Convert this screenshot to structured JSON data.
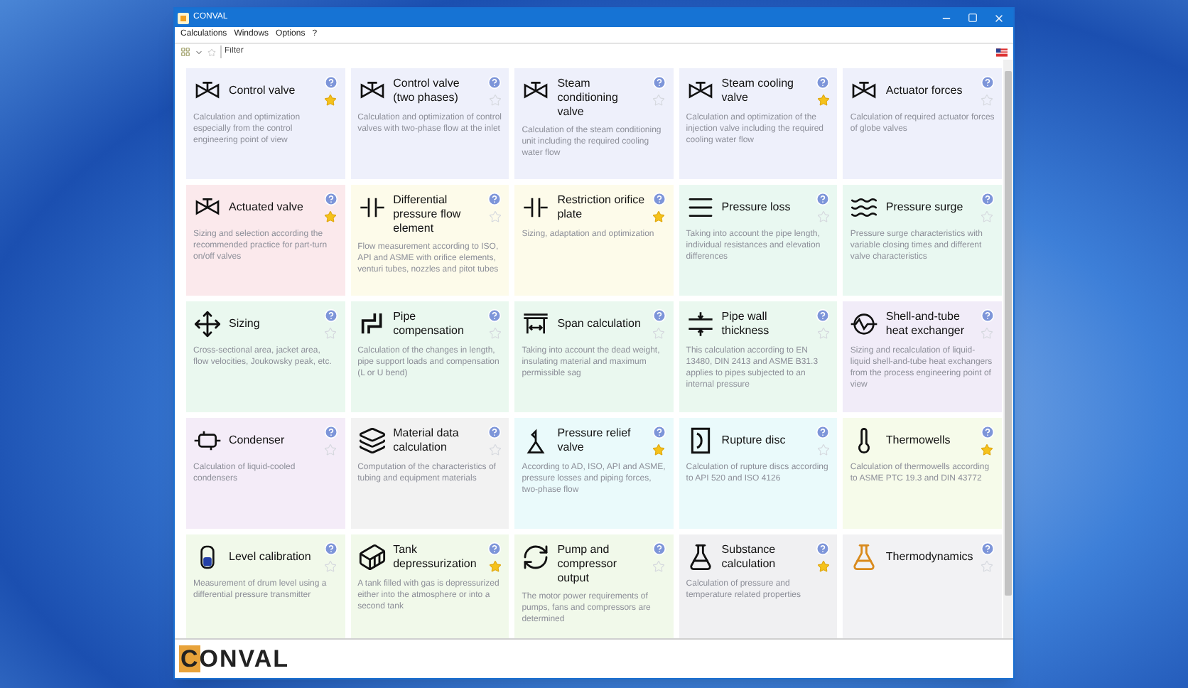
{
  "window": {
    "title": "CONVAL"
  },
  "menu": [
    {
      "label": "Calculations"
    },
    {
      "label": "Windows"
    },
    {
      "label": "Options"
    },
    {
      "label": "?"
    }
  ],
  "toolbar": {
    "filter": {
      "placeholder": "Filter"
    }
  },
  "cards": [
    {
      "title": "Control valve",
      "description": "Calculation and optimization especially from the control engineering point of view",
      "favorite": true,
      "color": "#eef0fb"
    },
    {
      "title": "Control valve (two phases)",
      "description": "Calculation and optimization of control valves with two-phase flow at the inlet",
      "favorite": false,
      "color": "#eef0fb"
    },
    {
      "title": "Steam conditioning valve",
      "description": "Calculation of the steam conditioning unit including the required cooling water flow",
      "favorite": false,
      "color": "#eef0fb"
    },
    {
      "title": "Steam cooling valve",
      "description": "Calculation and optimization of the injection valve including the required cooling water flow",
      "favorite": true,
      "color": "#eef0fb"
    },
    {
      "title": "Actuator forces",
      "description": "Calculation of required actuator forces of globe valves",
      "favorite": false,
      "color": "#eef0fb"
    },
    {
      "title": "Actuated valve",
      "description": "Sizing and selection according the recommended practice for part-turn on/off valves",
      "favorite": true,
      "color": "#fbe9ec"
    },
    {
      "title": "Differential pressure flow element",
      "description": "Flow measurement according to ISO, API and ASME with orifice elements, venturi tubes, nozzles and pitot tubes",
      "favorite": false,
      "color": "#fdfbea"
    },
    {
      "title": "Restriction orifice plate",
      "description": "Sizing, adaptation and optimization",
      "favorite": true,
      "color": "#fdfbea"
    },
    {
      "title": "Pressure loss",
      "description": "Taking into account the pipe length, individual resistances and elevation differences",
      "favorite": false,
      "color": "#e9f8f1"
    },
    {
      "title": "Pressure surge",
      "description": "Pressure surge characteristics with variable closing times and different valve characteristics",
      "favorite": false,
      "color": "#e9f8f1"
    },
    {
      "title": "Sizing",
      "description": "Cross-sectional area, jacket area, flow velocities, Joukowsky peak, etc.",
      "favorite": false,
      "color": "#eaf8ef"
    },
    {
      "title": "Pipe compensation",
      "description": "Calculation of the changes in length, pipe support loads and compensation (L or U bend)",
      "favorite": false,
      "color": "#eaf8ef"
    },
    {
      "title": "Span calculation",
      "description": "Taking into account the dead weight, insulating material and maximum permissible sag",
      "favorite": false,
      "color": "#eaf8ef"
    },
    {
      "title": "Pipe wall thickness",
      "description": "This calculation according to EN 13480, DIN 2413 and ASME B31.3 applies to pipes subjected to an internal pressure",
      "favorite": false,
      "color": "#eaf8ef"
    },
    {
      "title": "Shell-and-tube heat exchanger",
      "description": "Sizing and recalculation of liquid-liquid shell-and-tube heat exchangers from the process engineering point of view",
      "favorite": false,
      "color": "#f1ecf8"
    },
    {
      "title": "Condenser",
      "description": "Calculation of liquid-cooled condensers",
      "favorite": false,
      "color": "#f4ecf8"
    },
    {
      "title": "Material data calculation",
      "description": "Computation of the characteristics of tubing and equipment materials",
      "favorite": false,
      "color": "#f2f2f2"
    },
    {
      "title": "Pressure relief valve",
      "description": "According to AD, ISO, API and ASME, pressure losses and piping forces, two-phase flow",
      "favorite": true,
      "color": "#eafafb"
    },
    {
      "title": "Rupture disc",
      "description": "Calculation of rupture discs according to API 520 and ISO 4126",
      "favorite": false,
      "color": "#eafafb"
    },
    {
      "title": "Thermowells",
      "description": "Calculation of thermowells according to ASME PTC 19.3 and DIN 43772",
      "favorite": true,
      "color": "#f6fbea"
    },
    {
      "title": "Level calibration",
      "description": "Measurement of drum level using a differential pressure transmitter",
      "favorite": false,
      "color": "#f1f9ea"
    },
    {
      "title": "Tank depressurization",
      "description": "A tank filled with gas is depressurized either into the atmosphere or into a second tank",
      "favorite": true,
      "color": "#f1f9ea"
    },
    {
      "title": "Pump and compressor output",
      "description": "The motor power requirements of pumps, fans and compressors are determined",
      "favorite": false,
      "color": "#f1f9ea"
    },
    {
      "title": "Substance calculation",
      "description": "Calculation of pressure and temperature related properties",
      "favorite": true,
      "color": "#f0f0f2"
    },
    {
      "title": "Thermodynamics",
      "favorite": false,
      "color": "#f2f2f4"
    }
  ],
  "logo": {
    "text": "CONVAL"
  }
}
